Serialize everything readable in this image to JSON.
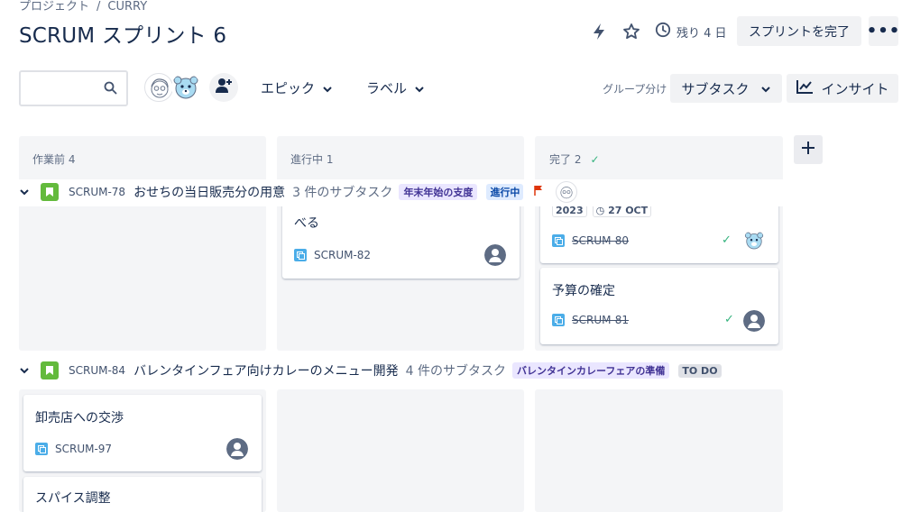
{
  "breadcrumb": {
    "project": "プロジェクト",
    "separator": "/",
    "name": "CURRY"
  },
  "page_title": "SCRUM スプリント 6",
  "header": {
    "days_left": "残り 4 日",
    "complete_sprint": "スプリントを完了",
    "more": "•••"
  },
  "toolbar": {
    "search_value": "",
    "filter_epic": "エピック",
    "filter_label": "ラベル",
    "group_by_label": "グループ分け",
    "group_by_value": "サブタスク",
    "insights": "インサイト"
  },
  "columns": [
    {
      "name": "作業前",
      "count": "4"
    },
    {
      "name": "進行中",
      "count": "1"
    },
    {
      "name": "完了",
      "count": "2"
    }
  ],
  "swimlanes": [
    {
      "key": "SCRUM-78",
      "title": "おせちの当日販売分の用意",
      "subtasks": "3 件のサブタスク",
      "epic": "年末年始の支度",
      "status": "進行中"
    },
    {
      "key": "SCRUM-84",
      "title": "バレンタインフェア向けカレーのメニュー開発",
      "subtasks": "4 件のサブタスク",
      "epic": "バレンタインカレーフェアの準備",
      "status": "TO DO"
    }
  ],
  "cards": {
    "progress_1": {
      "title_tail": "べる",
      "key": "SCRUM-82"
    },
    "done_1": {
      "year": "2023",
      "due": "27 OCT",
      "key": "SCRUM-80"
    },
    "done_2": {
      "title": "予算の確定",
      "key": "SCRUM-81"
    },
    "todo_1": {
      "title": "卸売店への交渉",
      "key": "SCRUM-97"
    },
    "todo_2": {
      "title": "スパイス調整"
    }
  },
  "colors": {
    "story_green": "#63ba3c",
    "subtask_blue": "#4bade8",
    "epic_purple_bg": "#eae6ff",
    "epic_purple_text": "#403294",
    "flag_red": "#de350b",
    "done_check": "#36b37e"
  },
  "icons": [
    "lightning-icon",
    "star-icon",
    "clock-icon",
    "search-icon",
    "add-person-icon",
    "chevron-down-icon",
    "insight-chart-icon",
    "plus-icon",
    "story-icon",
    "subtask-icon",
    "flag-icon",
    "check-icon",
    "avatar-default-icon"
  ]
}
